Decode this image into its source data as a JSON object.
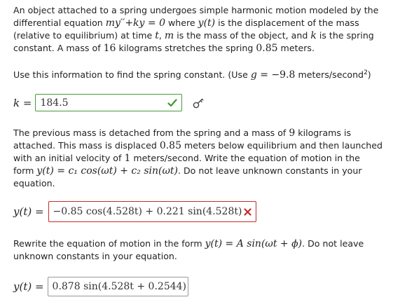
{
  "p1": {
    "l1a": "An object attached to a spring undergoes simple harmonic motion modeled by the",
    "l2a": "differential equation ",
    "l2eq": "my′′+ky = 0",
    "l2b": " where ",
    "l2y": "y(t)",
    "l2c": " is the displacement of the mass",
    "l3a": "(relative to equilibrium) at time ",
    "l3t": "t",
    "l3b": ", ",
    "l3m": "m",
    "l3c": " is the mass of the object, and ",
    "l3k": "k",
    "l3d": " is the spring",
    "l4a": "constant. A mass of ",
    "l4n": "16",
    "l4b": " kilograms stretches the spring ",
    "l4n2": "0.85",
    "l4c": " meters."
  },
  "p2": {
    "a": "Use this information to find the spring constant. (Use ",
    "g": "g",
    "eq": " = −9.8",
    "b": " meters/second",
    "sup": "2",
    "c": ")"
  },
  "q1": {
    "label": "k =",
    "value": "184.5"
  },
  "p3": {
    "l1a": "The previous mass is detached from the spring and a mass of ",
    "l1n": "9",
    "l1b": " kilograms is",
    "l2a": "attached. This mass is displaced ",
    "l2n": "0.85",
    "l2b": " meters below equilibrium and then launched",
    "l3a": "with an initial velocity of ",
    "l3n": "1",
    "l3b": " meters/second. Write the equation of motion in the",
    "l4a": "form ",
    "l4eq": "y(t) = c₁ cos(ωt) + c₂ sin(ωt)",
    "l4b": ". Do not leave unknown constants in your",
    "l5": "equation."
  },
  "q2": {
    "label": "y(t) =",
    "value": "−0.85 cos(4.528t) + 0.221 sin(4.528t)"
  },
  "p4": {
    "l1a": "Rewrite the equation of motion in the form ",
    "l1eq": "y(t) = A sin(ωt + ϕ)",
    "l1b": ". Do not leave",
    "l2": "unknown constants in your equation."
  },
  "q3": {
    "label": "y(t) =",
    "value": "0.878 sin(4.528t + 0.2544)"
  },
  "colors": {
    "correct": "#3a9a2a",
    "incorrect": "#c42b2b"
  },
  "icons": {
    "correct": "check-icon",
    "incorrect": "x-icon",
    "key": "key-icon"
  }
}
